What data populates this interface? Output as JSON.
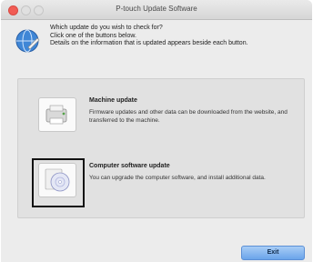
{
  "window": {
    "title": "P-touch Update Software"
  },
  "intro": {
    "line1": "Which update do you wish to check for?",
    "line2": "Click one of the buttons below.",
    "line3": "Details on the information that is updated appears beside each button.",
    "icon": "globe-update-icon"
  },
  "options": {
    "machine": {
      "title": "Machine update",
      "description": "Firmware updates and other data can be downloaded from the website, and transferred to the machine.",
      "icon": "printer-icon"
    },
    "computer": {
      "title": "Computer software update",
      "description": "You can upgrade the computer software, and install additional data.",
      "icon": "cd-disc-icon"
    }
  },
  "buttons": {
    "exit": "Exit"
  },
  "colors": {
    "close": "#f15c54",
    "exit_button": "#6aa4ea",
    "panel": "#e1e1e1",
    "highlight_border": "#111111"
  }
}
